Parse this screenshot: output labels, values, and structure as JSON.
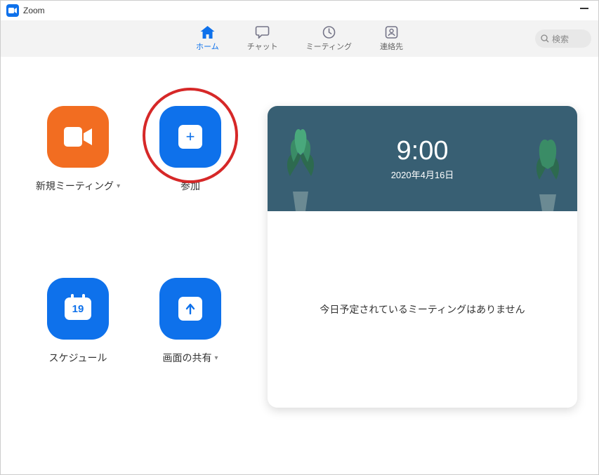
{
  "app": {
    "title": "Zoom"
  },
  "nav": {
    "home": "ホーム",
    "chat": "チャット",
    "meetings": "ミーティング",
    "contacts": "連絡先"
  },
  "search": {
    "placeholder": "検索"
  },
  "actions": {
    "new_meeting": "新規ミーティング",
    "join": "参加",
    "schedule": "スケジュール",
    "schedule_day": "19",
    "share_screen": "画面の共有"
  },
  "panel": {
    "time": "9:00",
    "date": "2020年4月16日",
    "no_meetings": "今日予定されているミーティングはありません"
  }
}
